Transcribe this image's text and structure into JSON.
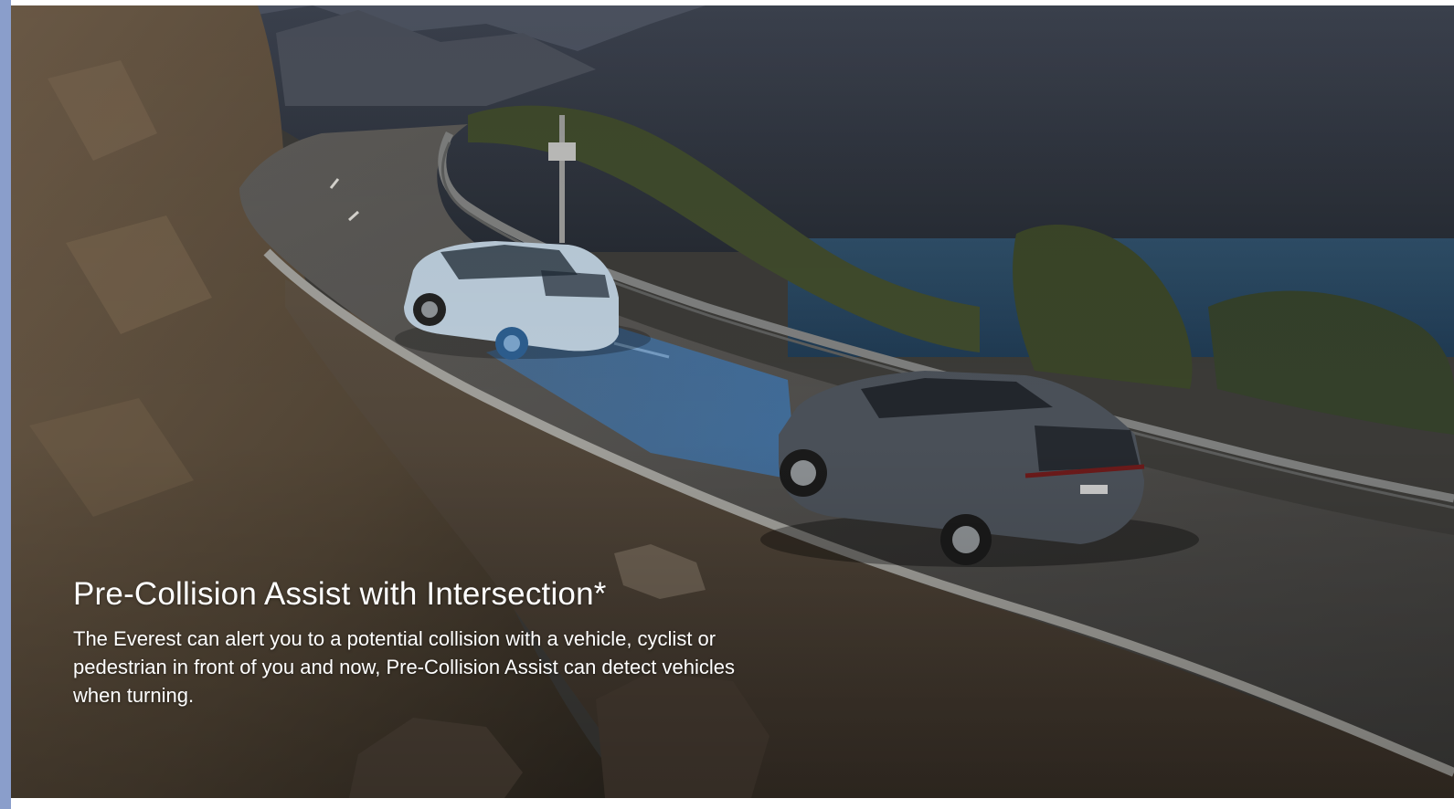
{
  "feature": {
    "title": "Pre-Collision Assist with Intersection*",
    "description": "The Everest can alert you to a potential collision with a vehicle, cyclist or pedestrian in front of you and now, Pre-Collision Assist can detect vehicles when turning."
  },
  "image": {
    "scene": "two-suvs-on-lakeside-mountain-road",
    "detection_zone_color": "#3a78b8",
    "accent_color": "#8a9ecb"
  }
}
